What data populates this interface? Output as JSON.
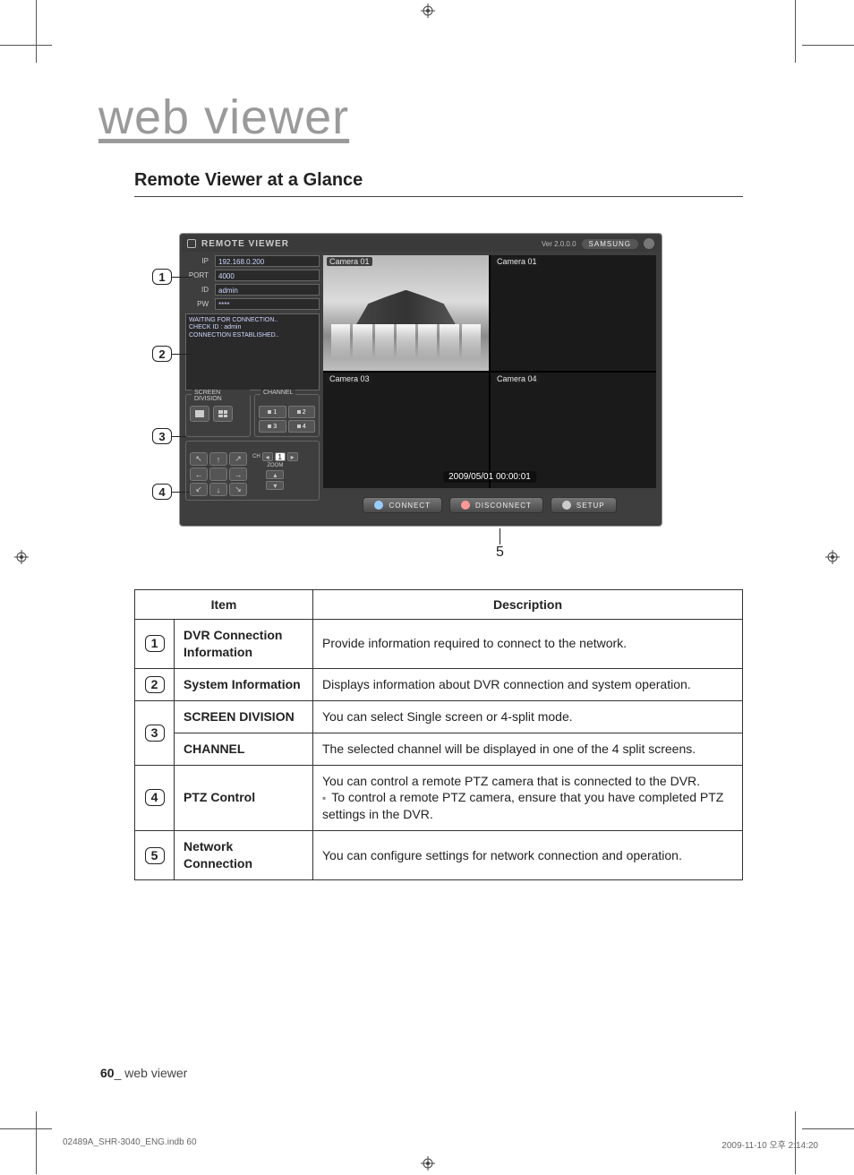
{
  "chapter_title": "web viewer",
  "section_title": "Remote Viewer at a Glance",
  "callouts": {
    "c1": "1",
    "c2": "2",
    "c3": "3",
    "c4": "4",
    "c5": "5"
  },
  "viewer": {
    "title": "REMOTE VIEWER",
    "version": "Ver 2.0.0.0",
    "brand": "SAMSUNG",
    "login": {
      "ip_label": "IP",
      "ip_value": "192.168.0.200",
      "port_label": "PORT",
      "port_value": "4000",
      "id_label": "ID",
      "id_value": "admin",
      "pw_label": "PW",
      "pw_value": "****"
    },
    "log_text": "WAITING FOR CONNECTION..\nCHECK ID : admin\nCONNECTION ESTABLISHED..",
    "screen_division_label": "SCREEN DIVISION",
    "channel_label": "CHANNEL",
    "channels": {
      "c1": "1",
      "c2": "2",
      "c3": "3",
      "c4": "4"
    },
    "ptz": {
      "ch_label": "CH",
      "ch_value": "1",
      "zoom_label": "ZOOM"
    },
    "cameras": {
      "cam1": "Camera 01",
      "cam2": "Camera 01",
      "cam3": "Camera 03",
      "cam4": "Camera 04"
    },
    "timestamp": "2009/05/01 00:00:01",
    "buttons": {
      "connect": "CONNECT",
      "disconnect": "DISCONNECT",
      "setup": "SETUP"
    }
  },
  "table": {
    "header_item": "Item",
    "header_desc": "Description",
    "rows": {
      "r1": {
        "num": "1",
        "name": "DVR Connection Information",
        "desc": "Provide information required to connect to the network."
      },
      "r2": {
        "num": "2",
        "name": "System Information",
        "desc": "Displays information about DVR connection and system operation."
      },
      "r3a": {
        "num": "3",
        "name": "SCREEN DIVISION",
        "desc": "You can select Single screen or 4-split mode."
      },
      "r3b": {
        "name": "CHANNEL",
        "desc": "The selected channel will be displayed in one of the 4 split screens."
      },
      "r4": {
        "num": "4",
        "name": "PTZ Control",
        "desc_line1": "You can control a remote PTZ camera that is connected to the DVR.",
        "desc_line2": "To control a remote PTZ camera, ensure that you have completed PTZ settings in the DVR."
      },
      "r5": {
        "num": "5",
        "name": "Network Connection",
        "desc": "You can configure settings for network connection and operation."
      }
    }
  },
  "footer": {
    "page_num": "60",
    "sep": "_",
    "section": "web viewer",
    "print_left": "02489A_SHR-3040_ENG.indb   60",
    "print_right": "2009-11-10   오후 2:14:20"
  }
}
